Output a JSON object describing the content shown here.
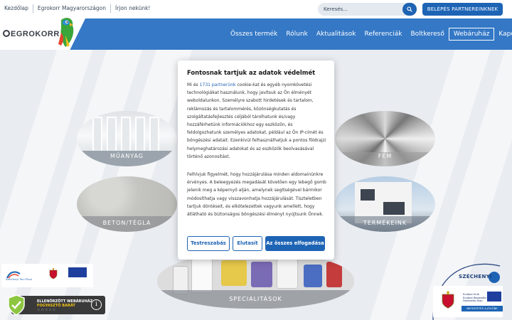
{
  "topbar": {
    "links": [
      "Kezdőlap",
      "Egrokorr Magyarországon",
      "Írjon nekünk!"
    ],
    "search_placeholder": "Keresés...",
    "partner_button": "BELÉPÉS PARTNEREINKNEK"
  },
  "header": {
    "logo_text": "EGROKORR"
  },
  "nav": {
    "items": [
      "Összes termék",
      "Rólunk",
      "Aktualitások",
      "Referenciák",
      "Boltkereső",
      "Webáruház",
      "Kapcsolatok"
    ],
    "active": "Webáruház"
  },
  "categories": {
    "muanyag": "MŰANYAG",
    "fem": "FÉM",
    "beton": "BETON/TÉGLA",
    "termekeink": "TERMÉKEINK",
    "specialitasok": "SPECIALITÁSOK"
  },
  "cookie_dialog": {
    "title": "Fontosnak tartjuk az adatok védelmét",
    "p1_before": "Mi és ",
    "p1_link": "1731 partnerünk",
    "p1_after": " cookie-kat és egyéb nyomkövetési technológiákat használunk, hogy javítsuk az Ön élményét weboldalunkon. Személyre szabott hirdetések és tartalom, reklámozás és tartalommérés, közönségkutatás és szolgáltatásfejlesztés céljából tárolhatunk és/vagy hozzáférhetünk információkhoz egy eszközön, és feldolgozhatunk személyes adatokat, például az Ön IP-címét és böngészési adatait. Ezenkívül felhasználhatjuk a pontos földrajzi helymeghatározási adatokat és az eszközök beolvasásával történő azonosítást.",
    "p2": "Felhívjuk figyelmét, hogy hozzájárulása minden aldomainünkre érvényes. A beleegyezés megadását követően egy lebegő gomb jelenik meg a képernyő alján, amelynek segítségével bármikor módosíthatja vagy visszavonhatja hozzájárulását. Tiszteletben tartjuk döntéseit, és elkötelezettek vagyunk amellett, hogy átlátható és biztonságos böngészési élményt nyújtsunk Önnek.",
    "btn_customize": "Testreszabás",
    "btn_reject": "Elutasít",
    "btn_accept": "Az összes elfogadása"
  },
  "badge": {
    "line1": "ELLENŐRZÖTT WEBÁRUHÁZ",
    "line2": "FOGYASZTÓ BARÁT",
    "stars": "☆☆☆☆☆",
    "info": "i"
  },
  "szechenyi_left": {
    "text": "Széchenyi Terv Plusz"
  },
  "szechenyi_right": {
    "title": "SZÉCHENYI",
    "eu_text": "Európai Unió Európai Regionális Fejlesztési Alap",
    "invest": "BEFEKTETÉS A JÖVŐBE"
  }
}
